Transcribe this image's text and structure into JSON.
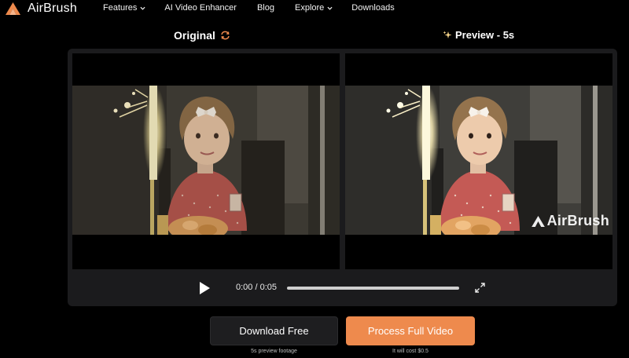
{
  "app": {
    "name": "AirBrush"
  },
  "nav": {
    "items": [
      {
        "label": "Features",
        "has_dropdown": true
      },
      {
        "label": "AI Video Enhancer",
        "has_dropdown": false
      },
      {
        "label": "Blog",
        "has_dropdown": false
      },
      {
        "label": "Explore",
        "has_dropdown": true
      },
      {
        "label": "Downloads",
        "has_dropdown": false
      }
    ]
  },
  "comparison": {
    "original_label": "Original",
    "original_icon": "refresh-icon",
    "preview_label": "Preview - 5s",
    "preview_icon": "sparkle-icon",
    "watermark": "AirBrush"
  },
  "player": {
    "play_icon": "play-icon",
    "time": "0:00 / 0:05",
    "progress": 0,
    "fullscreen_icon": "expand-icon"
  },
  "actions": {
    "download_label": "Download Free",
    "download_sub": "5s preview footage",
    "process_label": "Process Full Video",
    "process_sub": "It will cost $0.5"
  },
  "colors": {
    "accent": "#ee8a4d",
    "background": "#000000",
    "panel": "#1b1b1d"
  }
}
